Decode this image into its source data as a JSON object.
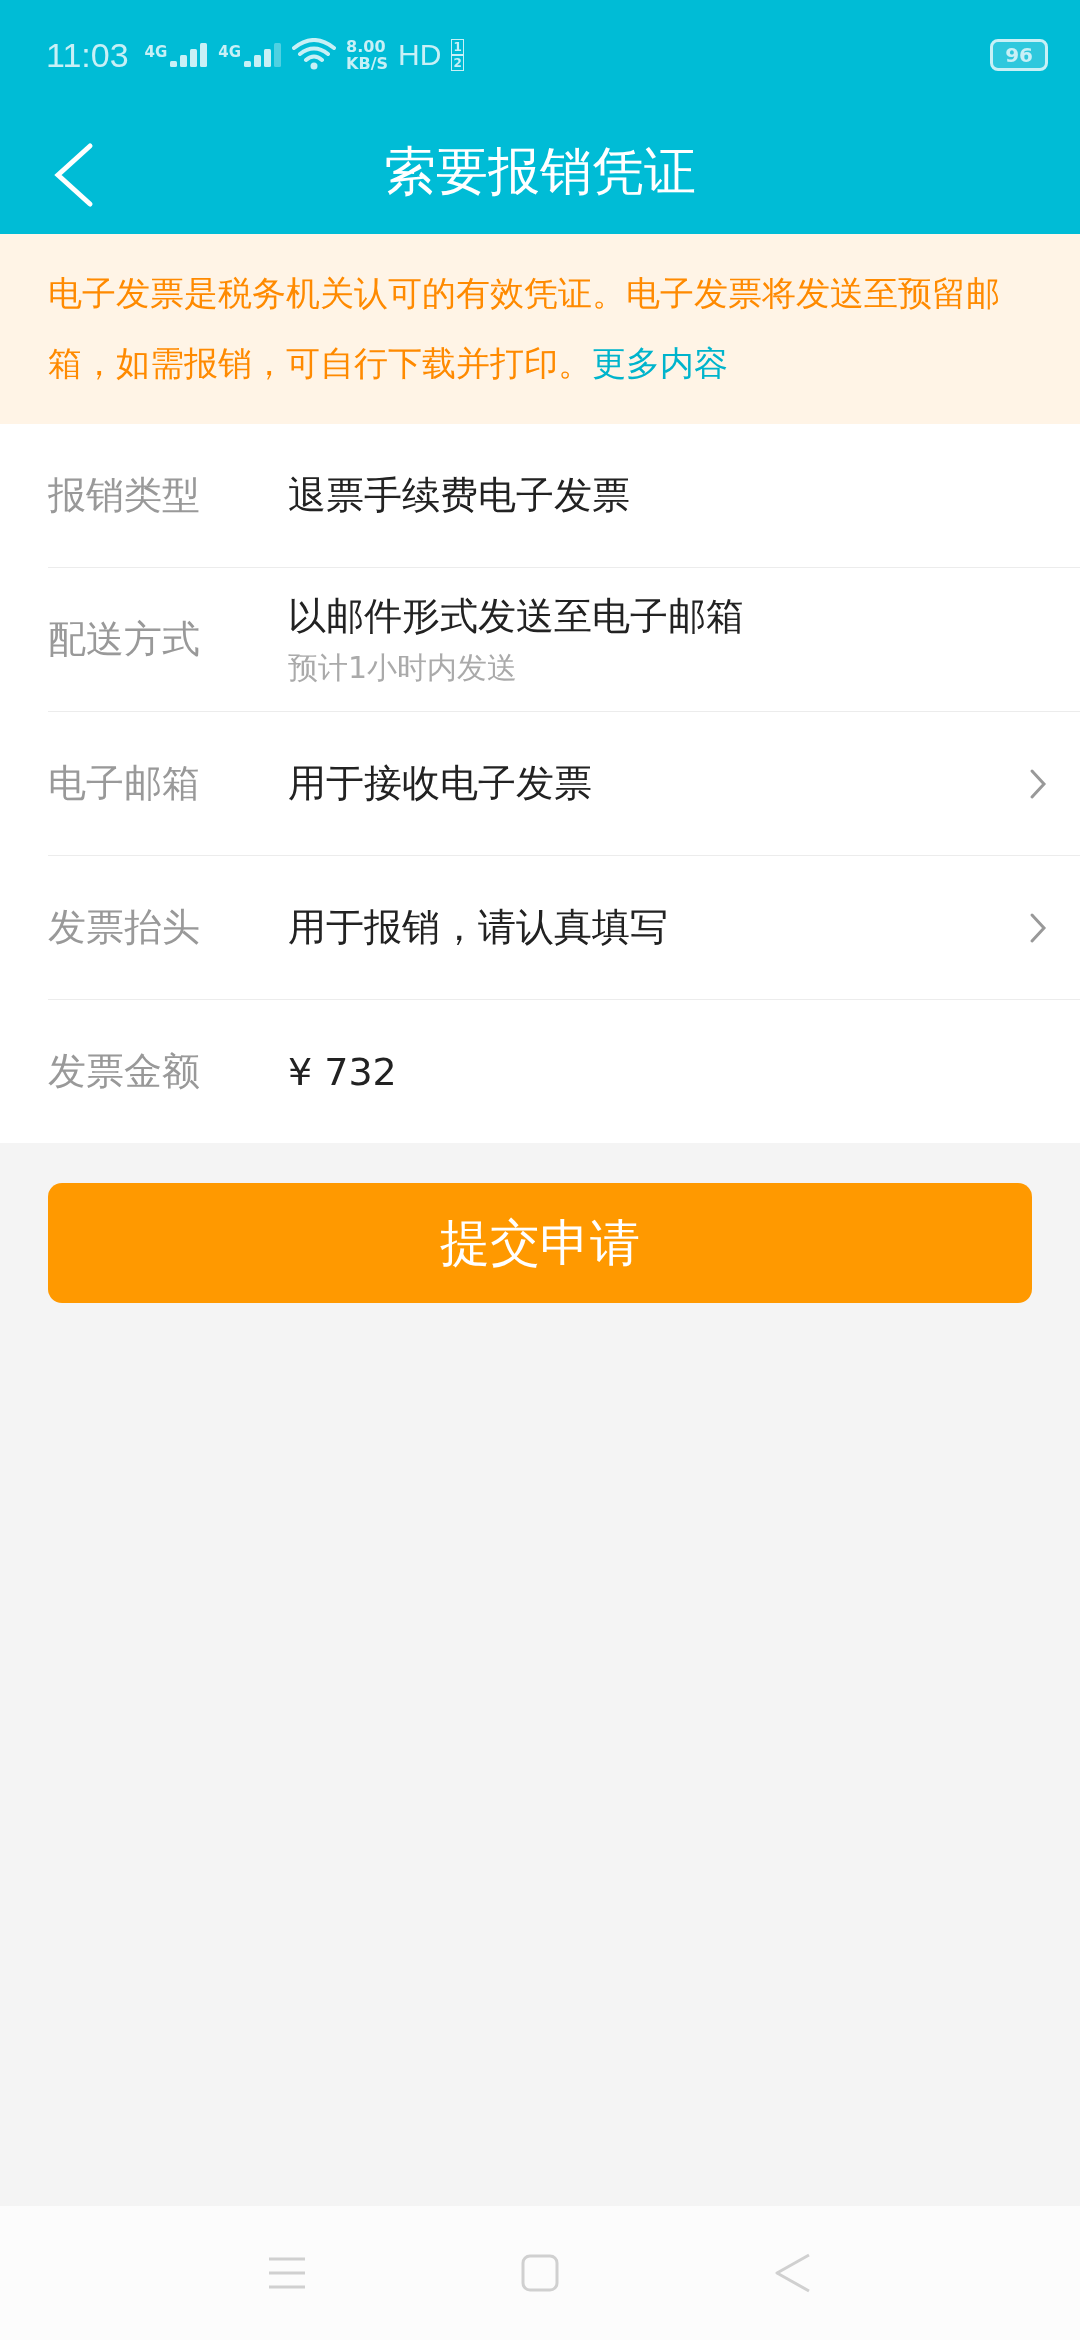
{
  "status_bar": {
    "time": "11:03",
    "networks": [
      "4G",
      "4G"
    ],
    "speed_value": "8.00",
    "speed_unit": "KB/S",
    "hd": "HD",
    "sims": [
      "1",
      "2"
    ],
    "battery": "96"
  },
  "header": {
    "title": "索要报销凭证"
  },
  "notice": {
    "text": "电子发票是税务机关认可的有效凭证。电子发票将发送至预留邮箱，如需报销，可自行下载并打印。",
    "link": "更多内容"
  },
  "rows": [
    {
      "kind": "static",
      "label": "报销类型",
      "value": "退票手续费电子发票"
    },
    {
      "kind": "static",
      "label": "配送方式",
      "value": "以邮件形式发送至电子邮箱",
      "sub": "预计1小时内发送"
    },
    {
      "kind": "link",
      "label": "电子邮箱",
      "value": "用于接收电子发票"
    },
    {
      "kind": "link",
      "label": "发票抬头",
      "value": "用于报销，请认真填写"
    },
    {
      "kind": "static",
      "label": "发票金额",
      "value": "¥ 732"
    }
  ],
  "submit_button": "提交申请"
}
